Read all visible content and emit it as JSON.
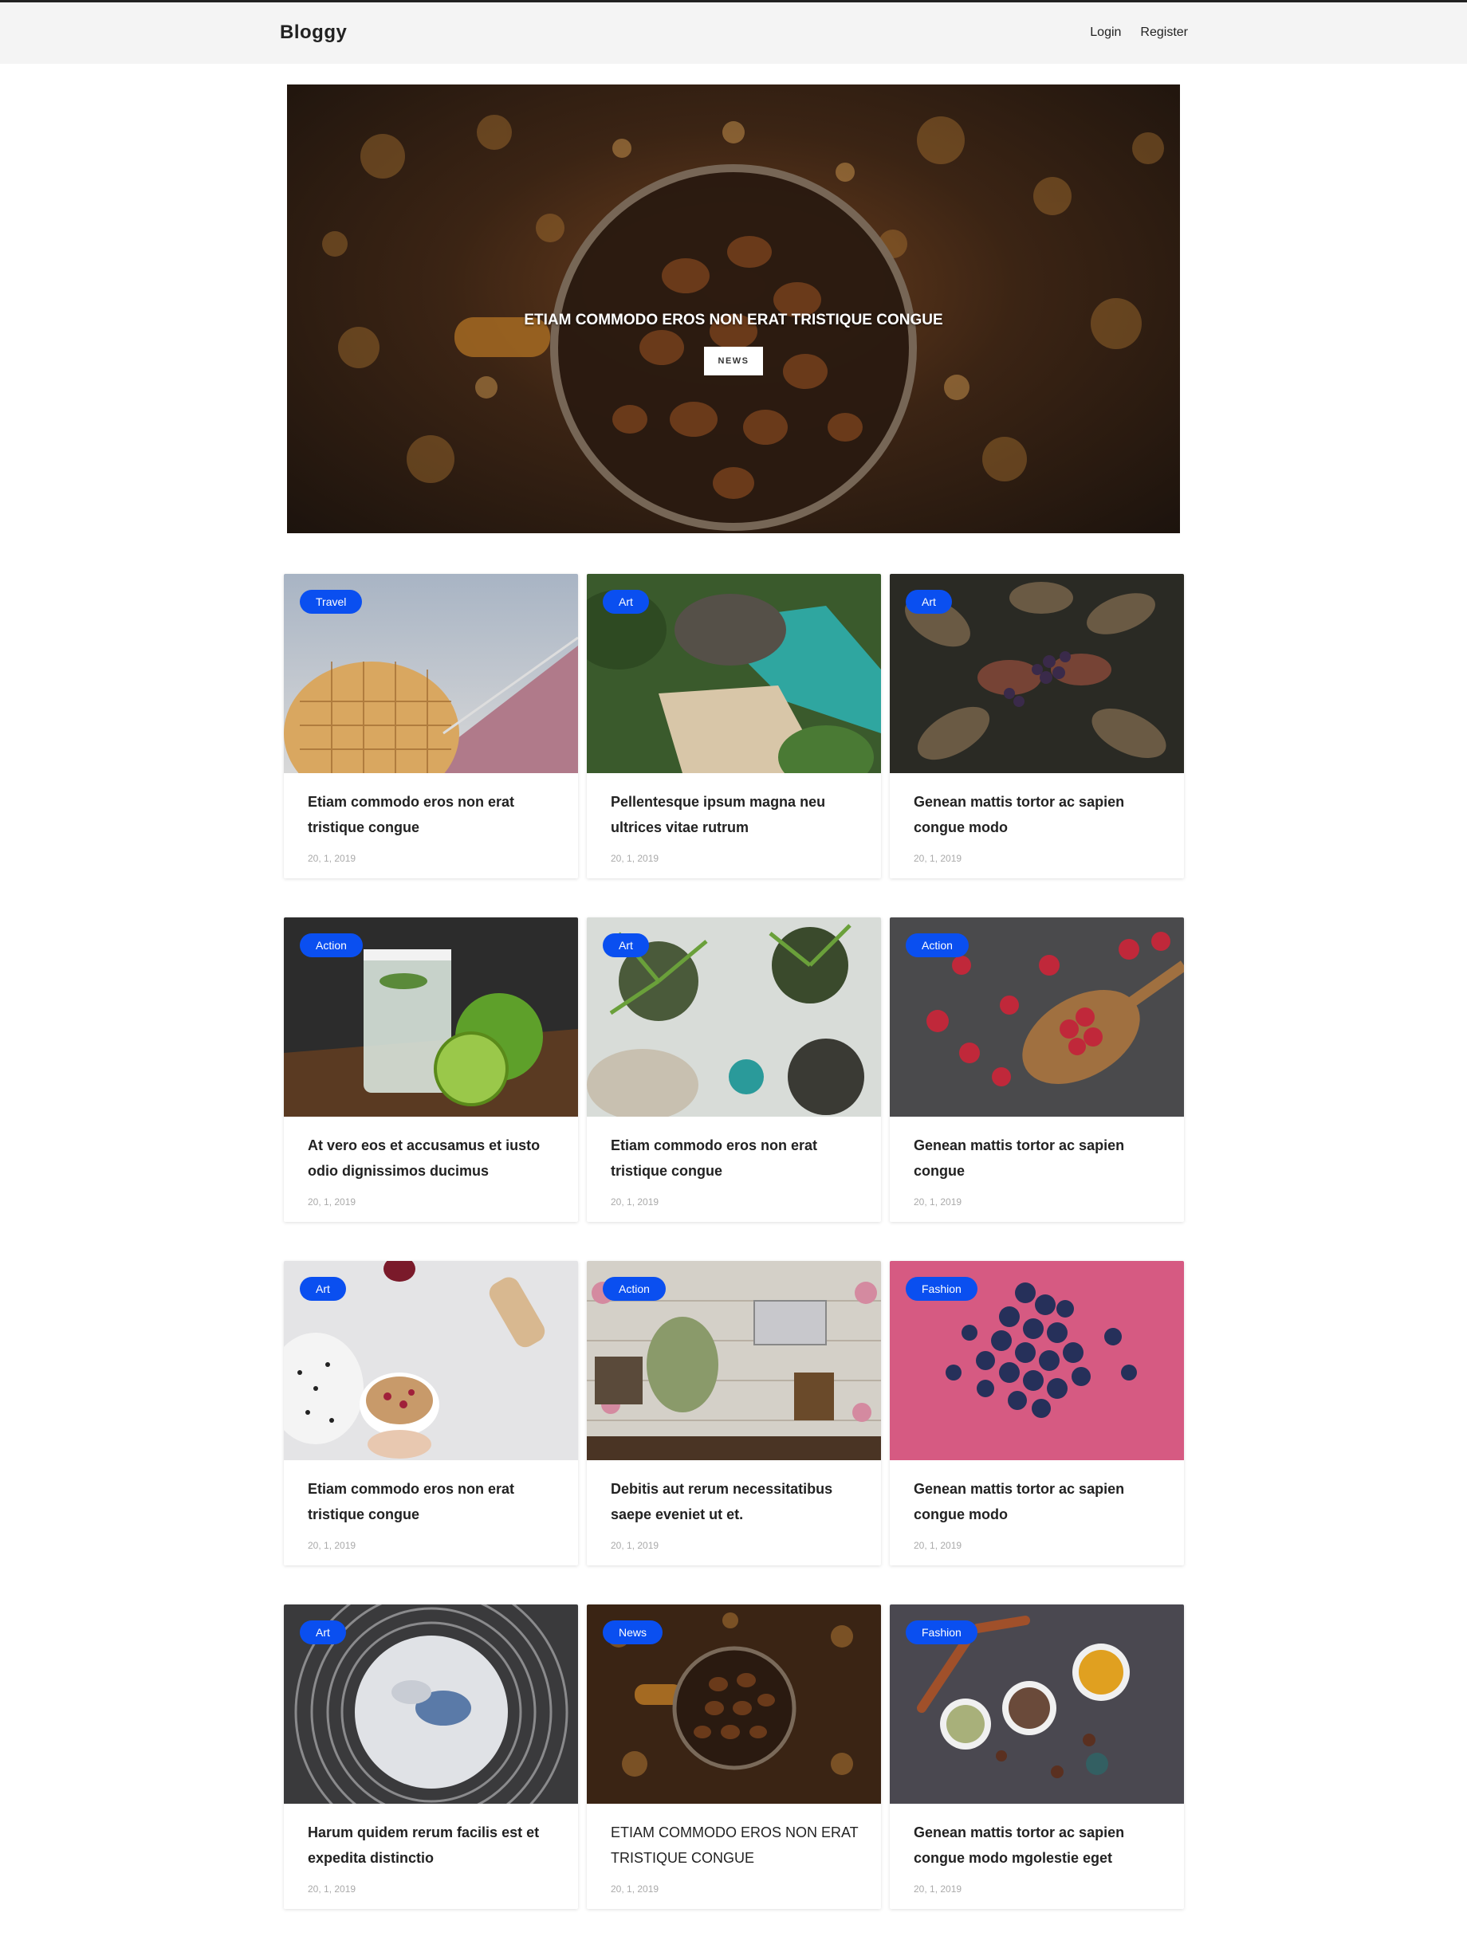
{
  "navbar": {
    "brand": "Bloggy",
    "links": [
      "Login",
      "Register"
    ]
  },
  "hero": {
    "title": "ETIAM COMMODO EROS NON ERAT TRISTIQUE CONGUE",
    "tag": "NEWS"
  },
  "posts": [
    {
      "category": "Travel",
      "title": "Etiam commodo eros non erat tristique congue",
      "date": "20, 1, 2019"
    },
    {
      "category": "Art",
      "title": "Pellentesque ipsum magna neu ultrices vitae rutrum",
      "date": "20, 1, 2019"
    },
    {
      "category": "Art",
      "title": "Genean mattis tortor ac sapien congue modo",
      "date": "20, 1, 2019"
    },
    {
      "category": "Action",
      "title": "At vero eos et accusamus et iusto odio dignissimos ducimus",
      "date": "20, 1, 2019"
    },
    {
      "category": "Art",
      "title": "Etiam commodo eros non erat tristique congue",
      "date": "20, 1, 2019"
    },
    {
      "category": "Action",
      "title": "Genean mattis tortor ac sapien congue",
      "date": "20, 1, 2019"
    },
    {
      "category": "Art",
      "title": "Etiam commodo eros non erat tristique congue",
      "date": "20, 1, 2019"
    },
    {
      "category": "Action",
      "title": "Debitis aut rerum necessitatibus saepe eveniet ut et.",
      "date": "20, 1, 2019"
    },
    {
      "category": "Fashion",
      "title": "Genean mattis tortor ac sapien congue modo",
      "date": "20, 1, 2019"
    },
    {
      "category": "Art",
      "title": "Harum quidem rerum facilis est et expedita distinctio",
      "date": "20, 1, 2019"
    },
    {
      "category": "News",
      "title": "ETIAM COMMODO EROS NON ERAT TRISTIQUE CONGUE",
      "date": "20, 1, 2019"
    },
    {
      "category": "Fashion",
      "title": "Genean mattis tortor ac sapien congue modo mgolestie eget",
      "date": "20, 1, 2019"
    }
  ],
  "colors": {
    "badge": "#0a4ff0",
    "navbar_bg": "#f4f4f4"
  }
}
